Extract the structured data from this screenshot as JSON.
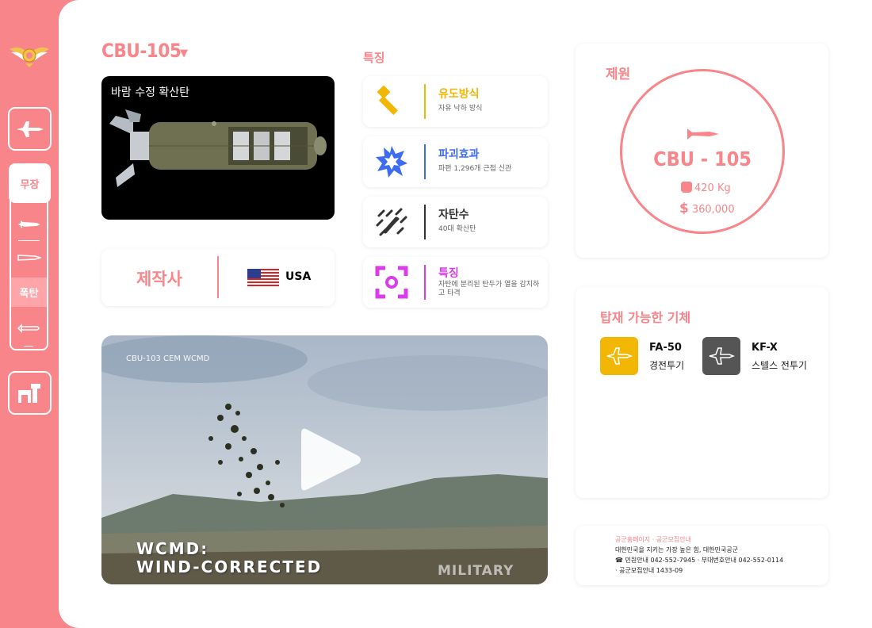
{
  "sidebar": {
    "tab_label": "무장",
    "active_sub_label": "폭탄"
  },
  "weapon": {
    "title": "CBU-105",
    "caption": "바람 수정 확산탄"
  },
  "maker": {
    "label": "제작사",
    "country": "USA"
  },
  "features": {
    "header": "특징",
    "items": [
      {
        "title": "유도방식",
        "desc": "자유 낙하 방식",
        "color": "#f2b705"
      },
      {
        "title": "파괴효과",
        "desc": "파편 1,296개 근접 신관",
        "color": "#3d6cf0"
      },
      {
        "title": "자탄수",
        "desc": "40대 확산탄",
        "color": "#333333"
      },
      {
        "title": "특징",
        "desc": "자탄에 분리된 탄두가 열을 감지하고 타격",
        "color": "#d93ce8"
      }
    ]
  },
  "video": {
    "tag": "CBU-103 CEM WCMD",
    "subtitle_line1": "WCMD:",
    "subtitle_line2": "WIND-CORRECTED",
    "brand": "MILITARY"
  },
  "specs": {
    "label": "제원",
    "name": "CBU - 105",
    "weight": "420 Kg",
    "price": "360,000"
  },
  "aircraft": {
    "label": "탑재 가능한 기체",
    "items": [
      {
        "name": "FA-50",
        "type": "경전투기",
        "color": "#f2b705"
      },
      {
        "name": "KF-X",
        "type": "스텔스 전투기",
        "color": "#555555"
      }
    ]
  },
  "footer": {
    "links": "공군홈페이지 · 공군모집안내",
    "slogan": "대한민국을 지키는 가장 높은 힘, 대한민국공군",
    "phones": "☎ 민원안내 042-552-7945 · 부대번호안내 042-552-0114",
    "recruit": "· 공군모집안내 1433-09"
  }
}
